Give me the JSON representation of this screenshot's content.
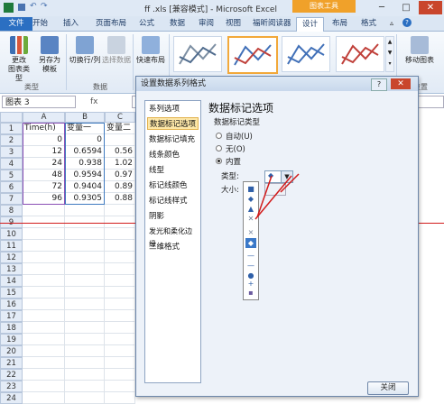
{
  "window": {
    "title": "ff .xls  [兼容模式] - Microsoft Excel",
    "chart_tools": "图表工具",
    "min": "─",
    "max": "□",
    "close": "✕"
  },
  "tabs": [
    "文件",
    "开始",
    "插入",
    "页面布局",
    "公式",
    "数据",
    "审阅",
    "视图",
    "福昕阅读器",
    "设计",
    "布局",
    "格式"
  ],
  "ribbon": {
    "change_type": "更改\n图表类型",
    "save_template": "另存为\n模板",
    "switch_rowcol": "切换行/列",
    "select_data": "选择数据",
    "quick_layout": "快速布局",
    "move_chart": "移动图表",
    "group_type": "类型",
    "group_data": "数据",
    "group_location": "位置"
  },
  "namebox": "图表 3",
  "fx": "fx",
  "columns": [
    "A",
    "B",
    "C"
  ],
  "rows": [
    {
      "n": "1",
      "a": "Time(h)",
      "b": "变量一",
      "c": "变量二"
    },
    {
      "n": "2",
      "a": "0",
      "b": "0",
      "c": ""
    },
    {
      "n": "3",
      "a": "12",
      "b": "0.6594",
      "c": "0.56"
    },
    {
      "n": "4",
      "a": "24",
      "b": "0.938",
      "c": "1.02"
    },
    {
      "n": "5",
      "a": "48",
      "b": "0.9594",
      "c": "0.97"
    },
    {
      "n": "6",
      "a": "72",
      "b": "0.9404",
      "c": "0.89"
    },
    {
      "n": "7",
      "a": "96",
      "b": "0.9305",
      "c": "0.88"
    },
    {
      "n": "8",
      "a": "",
      "b": "",
      "c": ""
    },
    {
      "n": "9",
      "a": "",
      "b": "",
      "c": ""
    },
    {
      "n": "10",
      "a": "",
      "b": "",
      "c": ""
    },
    {
      "n": "11",
      "a": "",
      "b": "",
      "c": ""
    },
    {
      "n": "12",
      "a": "",
      "b": "",
      "c": ""
    },
    {
      "n": "13",
      "a": "",
      "b": "",
      "c": ""
    },
    {
      "n": "14",
      "a": "",
      "b": "",
      "c": ""
    },
    {
      "n": "15",
      "a": "",
      "b": "",
      "c": ""
    },
    {
      "n": "16",
      "a": "",
      "b": "",
      "c": ""
    },
    {
      "n": "17",
      "a": "",
      "b": "",
      "c": ""
    },
    {
      "n": "18",
      "a": "",
      "b": "",
      "c": ""
    },
    {
      "n": "19",
      "a": "",
      "b": "",
      "c": ""
    },
    {
      "n": "20",
      "a": "",
      "b": "",
      "c": ""
    },
    {
      "n": "21",
      "a": "",
      "b": "",
      "c": ""
    },
    {
      "n": "22",
      "a": "",
      "b": "",
      "c": ""
    },
    {
      "n": "23",
      "a": "",
      "b": "",
      "c": ""
    },
    {
      "n": "24",
      "a": "",
      "b": "",
      "c": ""
    }
  ],
  "dialog": {
    "title": "设置数据系列格式",
    "help": "?",
    "close": "✕",
    "nav": [
      "系列选项",
      "数据标记选项",
      "数据标记填充",
      "线条颜色",
      "线型",
      "标记线颜色",
      "标记线样式",
      "阴影",
      "发光和柔化边缘",
      "三维格式"
    ],
    "heading": "数据标记选项",
    "marker_type_label": "数据标记类型",
    "options": [
      "自动(U)",
      "无(O)",
      "内置"
    ],
    "type_label": "类型:",
    "size_label": "大小:",
    "close_button": "关闭"
  },
  "marker_list": [
    "■",
    "◆",
    "▲",
    "✕",
    "×",
    "◆",
    "—",
    "—",
    "●",
    "+",
    "▪"
  ]
}
